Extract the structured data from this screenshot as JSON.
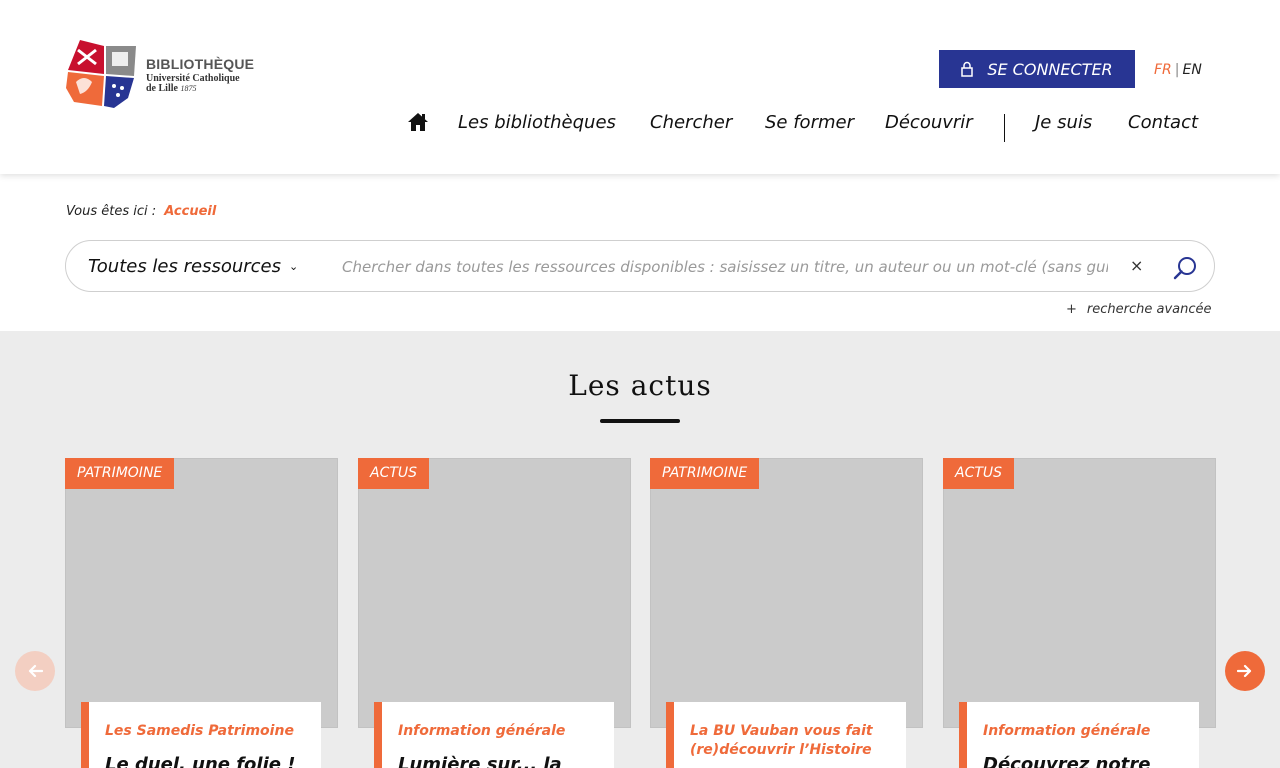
{
  "logo": {
    "title": "BIBLIOTHÈQUE",
    "line2": "Université Catholique",
    "line3": "de Lille",
    "year": "1875"
  },
  "header": {
    "connect_label": "SE CONNECTER",
    "lang_fr": "FR",
    "lang_sep": "|",
    "lang_en": "EN"
  },
  "nav": {
    "items": [
      "Les bibliothèques",
      "Chercher",
      "Se former",
      "Découvrir",
      "Je suis",
      "Contact"
    ]
  },
  "breadcrumb": {
    "prefix": "Vous êtes ici :",
    "current": "Accueil"
  },
  "search": {
    "scope": "Toutes les ressources",
    "placeholder": "Chercher dans toutes les ressources disponibles : saisissez un titre, un auteur ou un mot-clé (sans guillemets)",
    "clear": "×",
    "advanced": "recherche avancée",
    "advanced_plus": "+"
  },
  "news": {
    "title": "Les actus",
    "cards": [
      {
        "tag": "PATRIMOINE",
        "category": "Les Samedis Patrimoine",
        "headline": "Le duel, une folie !"
      },
      {
        "tag": "ACTUS",
        "category": "Information générale",
        "headline": "Lumière sur... la"
      },
      {
        "tag": "PATRIMOINE",
        "category": "La BU Vauban vous fait (re)découvrir l’Histoire",
        "headline": ""
      },
      {
        "tag": "ACTUS",
        "category": "Information générale",
        "headline": "Découvrez notre"
      }
    ]
  },
  "colors": {
    "accent": "#ef6a3a",
    "primary": "#283593",
    "section_bg": "#ececec"
  }
}
